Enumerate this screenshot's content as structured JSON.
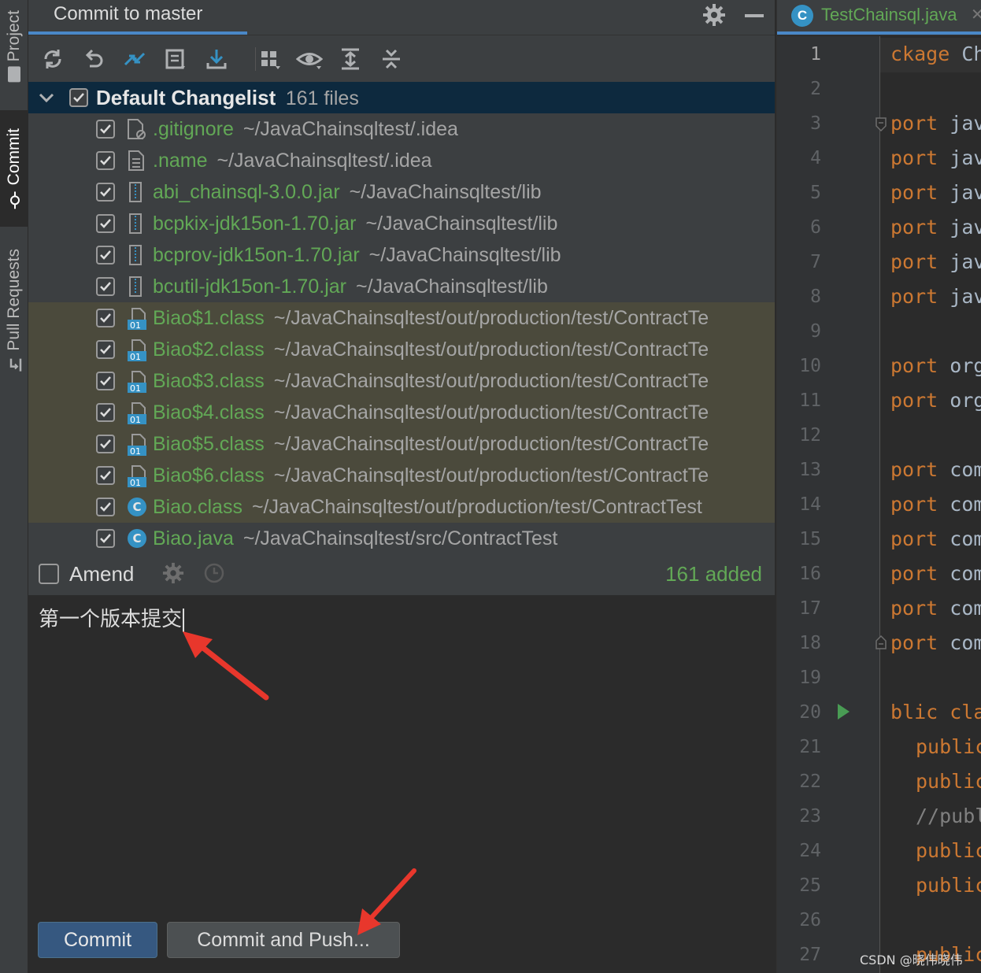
{
  "tool_stripe": {
    "tabs": [
      {
        "label": "Project"
      },
      {
        "label": "Commit"
      },
      {
        "label": "Pull Requests"
      }
    ]
  },
  "commit_panel": {
    "title": "Commit to master",
    "changelist": {
      "name": "Default Changelist",
      "count": "161 files",
      "files": [
        {
          "name": ".gitignore",
          "path": "~/JavaChainsqltest/.idea",
          "icon": "ignore-file-icon",
          "highlight": false
        },
        {
          "name": ".name",
          "path": "~/JavaChainsqltest/.idea",
          "icon": "text-file-icon",
          "highlight": false
        },
        {
          "name": "abi_chainsql-3.0.0.jar",
          "path": "~/JavaChainsqltest/lib",
          "icon": "jar-file-icon",
          "highlight": false
        },
        {
          "name": "bcpkix-jdk15on-1.70.jar",
          "path": "~/JavaChainsqltest/lib",
          "icon": "jar-file-icon",
          "highlight": false
        },
        {
          "name": "bcprov-jdk15on-1.70.jar",
          "path": "~/JavaChainsqltest/lib",
          "icon": "jar-file-icon",
          "highlight": false
        },
        {
          "name": "bcutil-jdk15on-1.70.jar",
          "path": "~/JavaChainsqltest/lib",
          "icon": "jar-file-icon",
          "highlight": false
        },
        {
          "name": "Biao$1.class",
          "path": "~/JavaChainsqltest/out/production/test/ContractTe",
          "icon": "binary-class-icon",
          "highlight": true
        },
        {
          "name": "Biao$2.class",
          "path": "~/JavaChainsqltest/out/production/test/ContractTe",
          "icon": "binary-class-icon",
          "highlight": true
        },
        {
          "name": "Biao$3.class",
          "path": "~/JavaChainsqltest/out/production/test/ContractTe",
          "icon": "binary-class-icon",
          "highlight": true
        },
        {
          "name": "Biao$4.class",
          "path": "~/JavaChainsqltest/out/production/test/ContractTe",
          "icon": "binary-class-icon",
          "highlight": true
        },
        {
          "name": "Biao$5.class",
          "path": "~/JavaChainsqltest/out/production/test/ContractTe",
          "icon": "binary-class-icon",
          "highlight": true
        },
        {
          "name": "Biao$6.class",
          "path": "~/JavaChainsqltest/out/production/test/ContractTe",
          "icon": "binary-class-icon",
          "highlight": true
        },
        {
          "name": "Biao.class",
          "path": "~/JavaChainsqltest/out/production/test/ContractTest",
          "icon": "class-icon",
          "highlight": true
        },
        {
          "name": "Biao.java",
          "path": "~/JavaChainsqltest/src/ContractTest",
          "icon": "class-icon",
          "highlight": false
        }
      ]
    },
    "amend_label": "Amend",
    "status": "161 added",
    "message": "第一个版本提交",
    "commit_label": "Commit",
    "commit_push_label": "Commit and Push..."
  },
  "editor": {
    "tab_label": "TestChainsql.java",
    "tab_icon": "java-class-icon",
    "lines": [
      {
        "n": "1",
        "kw": "ckage",
        "id": " Ch",
        "indent": 0
      },
      {
        "n": "2",
        "kw": "",
        "id": "",
        "indent": 0
      },
      {
        "n": "3",
        "kw": "port",
        "id": " jav",
        "indent": 0
      },
      {
        "n": "4",
        "kw": "port",
        "id": " jav",
        "indent": 0
      },
      {
        "n": "5",
        "kw": "port",
        "id": " jav",
        "indent": 0
      },
      {
        "n": "6",
        "kw": "port",
        "id": " jav",
        "indent": 0
      },
      {
        "n": "7",
        "kw": "port",
        "id": " jav",
        "indent": 0
      },
      {
        "n": "8",
        "kw": "port",
        "id": " jav",
        "indent": 0
      },
      {
        "n": "9",
        "kw": "",
        "id": "",
        "indent": 0
      },
      {
        "n": "10",
        "kw": "port",
        "id": " org",
        "indent": 0
      },
      {
        "n": "11",
        "kw": "port",
        "id": " org",
        "indent": 0
      },
      {
        "n": "12",
        "kw": "",
        "id": "",
        "indent": 0
      },
      {
        "n": "13",
        "kw": "port",
        "id": " com",
        "indent": 0
      },
      {
        "n": "14",
        "kw": "port",
        "id": " com",
        "indent": 0
      },
      {
        "n": "15",
        "kw": "port",
        "id": " com",
        "indent": 0
      },
      {
        "n": "16",
        "kw": "port",
        "id": " com",
        "indent": 0
      },
      {
        "n": "17",
        "kw": "port",
        "id": " com",
        "indent": 0
      },
      {
        "n": "18",
        "kw": "port",
        "id": " com",
        "indent": 0
      },
      {
        "n": "19",
        "kw": "",
        "id": "",
        "indent": 0
      },
      {
        "n": "20",
        "kw": "blic cla",
        "id": "",
        "indent": 0
      },
      {
        "n": "21",
        "kw": "public",
        "id": "",
        "indent": 1
      },
      {
        "n": "22",
        "kw": "public",
        "id": "",
        "indent": 1
      },
      {
        "n": "23",
        "kw": "",
        "id": "//publ",
        "indent": 1,
        "comment": true
      },
      {
        "n": "24",
        "kw": "public",
        "id": "",
        "indent": 1
      },
      {
        "n": "25",
        "kw": "public",
        "id": "",
        "indent": 1
      },
      {
        "n": "26",
        "kw": "",
        "id": "",
        "indent": 0
      },
      {
        "n": "27",
        "kw": "public",
        "id": "",
        "indent": 1
      }
    ]
  },
  "watermark": "CSDN @晓伟晓伟",
  "colors": {
    "accent": "#4a88c7",
    "added_file": "#62a856",
    "changelist_bg": "#0d293e",
    "highlight_row": "#4b4a3c",
    "arrow": "#e8372c"
  }
}
